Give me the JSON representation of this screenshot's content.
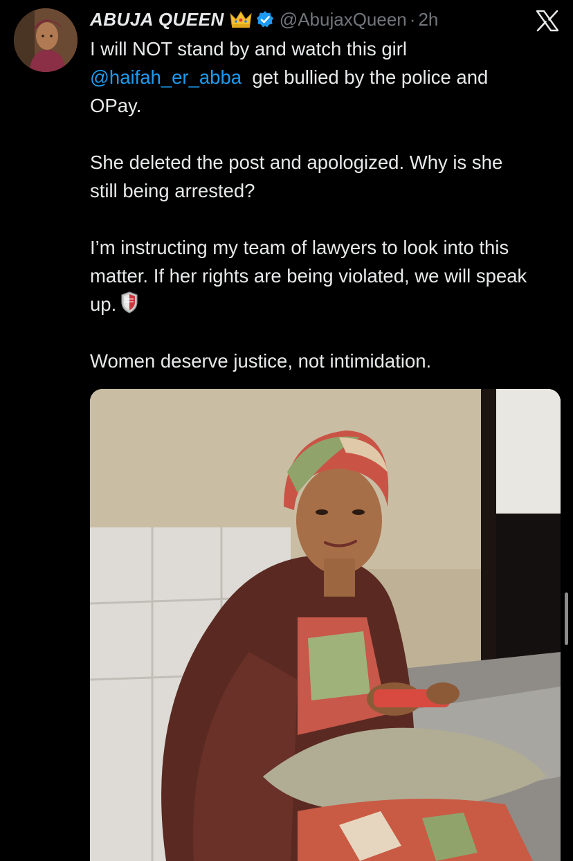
{
  "tweet": {
    "display_name": "ABUJA QUEEN",
    "handle": "@AbujaxQueen",
    "separator": "·",
    "time": "2h",
    "lines": {
      "l1": "I will NOT stand by and watch this girl",
      "mention": "@haifah_er_abba",
      "l2_rest": "get bullied by the police and",
      "l3": "OPay.",
      "p2": "She deleted the post and apologized. Why is she still being arrested?",
      "p3": "I’m instructing my team of lawyers to look into this matter. If her rights are being violated, we will speak up.",
      "p4": "Women deserve justice, not intimidation."
    },
    "icons": {
      "crown": "crown-emoji",
      "verified": "verified-badge-icon",
      "platform": "x-logo-icon",
      "shield": "shield-emoji"
    }
  },
  "colors": {
    "background": "#000000",
    "text": "#e7e9ea",
    "secondary_text": "#71767b",
    "mention": "#1d9bf0",
    "verified": "#1d9bf0"
  }
}
